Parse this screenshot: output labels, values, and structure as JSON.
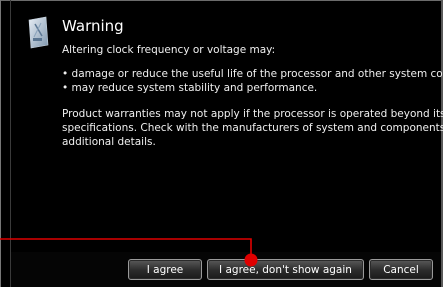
{
  "dialog": {
    "title": "Warning",
    "icon": "warning-shield-icon",
    "intro": "Altering clock frequency or voltage may:",
    "bullets": [
      "• damage or reduce the useful life of the processor and other system componer",
      "• may reduce system stability and performance."
    ],
    "note_lines": [
      "Product warranties may not apply if the processor is operated beyond its",
      "specifications. Check with the manufacturers of system and components for",
      "additional details."
    ]
  },
  "buttons": {
    "agree": "I agree",
    "agree_dont_show": "I agree, don't show again",
    "cancel": "Cancel"
  },
  "colors": {
    "background": "#000000",
    "text": "#ffffff",
    "annotation": "#e00000"
  }
}
